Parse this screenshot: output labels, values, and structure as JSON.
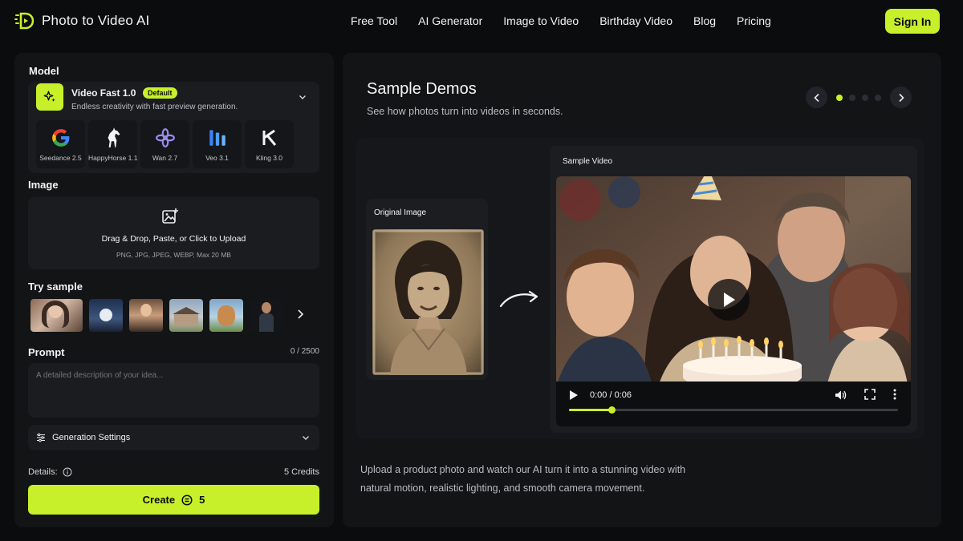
{
  "brand": {
    "name": "Photo to Video AI",
    "accent": "#c8f02a"
  },
  "nav": {
    "links": [
      "Free Tool",
      "AI Generator",
      "Image to Video",
      "Birthday Video",
      "Blog",
      "Pricing"
    ],
    "signin_label": "Sign In"
  },
  "left": {
    "model_label": "Model",
    "model": {
      "name": "Video Fast 1.0",
      "badge": "Default",
      "desc": "Endless creativity with fast preview generation."
    },
    "model_options": [
      {
        "label": "Seedance 2.5",
        "icon": "google-icon"
      },
      {
        "label": "HappyHorse 1.1",
        "icon": "horse-icon"
      },
      {
        "label": "Wan 2.7",
        "icon": "wan-icon"
      },
      {
        "label": "Veo 3.1",
        "icon": "veo-icon"
      },
      {
        "label": "Kling 3.0",
        "icon": "kling-icon"
      }
    ],
    "image_label": "Image",
    "upload": {
      "title": "Drag & Drop, Paste, or Click to Upload",
      "sub": "PNG, JPG, JPEG, WEBP, Max 20 MB"
    },
    "samples_label": "Try sample",
    "prompt": {
      "label": "Prompt",
      "count": "0 / 2500",
      "placeholder": "A detailed description of your idea..."
    },
    "settings_label": "Generation Settings",
    "details_label": "Details:",
    "credits_text": "5 Credits",
    "create": {
      "label": "Create",
      "cost": "5"
    }
  },
  "right": {
    "title": "Sample Demos",
    "subtitle": "See how photos turn into videos in seconds.",
    "carousel": {
      "total": 4,
      "active": 0
    },
    "original_label": "Original Image",
    "video_label": "Sample Video",
    "video": {
      "time": "0:00 / 0:06",
      "progress": 0.13
    },
    "description": "Upload a product photo and watch our AI turn it into a stunning video with natural motion, realistic lighting, and smooth camera movement."
  }
}
